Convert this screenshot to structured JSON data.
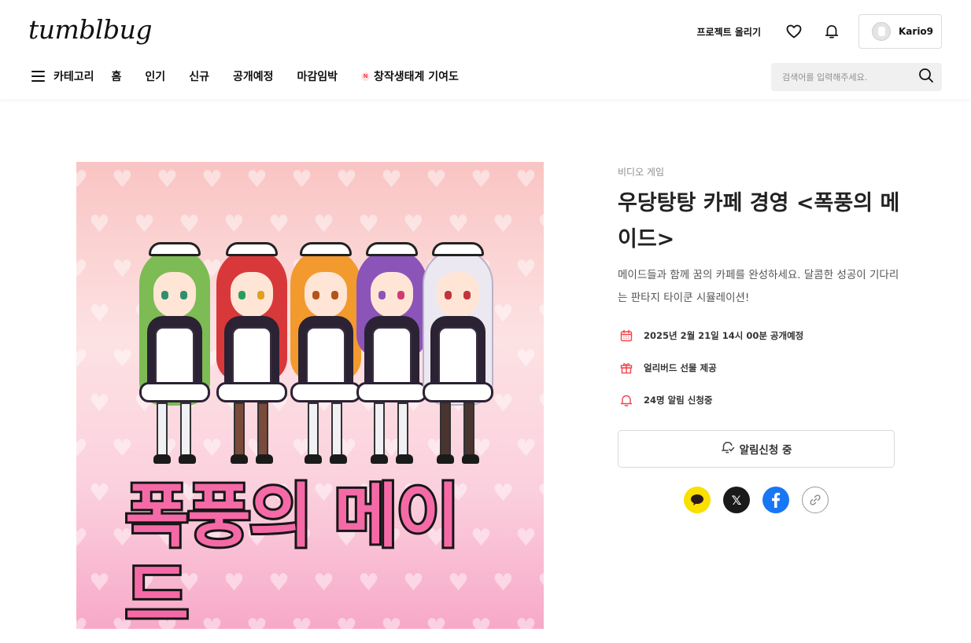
{
  "header": {
    "logo": "tumblbug",
    "upload_label": "프로젝트 올리기",
    "user_name": "Kario9"
  },
  "nav": {
    "category_label": "카테고리",
    "items": [
      "홈",
      "인기",
      "신규",
      "공개예정",
      "마감임박"
    ],
    "special_item": "창작생태계 기여도",
    "special_badge": "N"
  },
  "search": {
    "placeholder": "검색어를 입력해주세요."
  },
  "project": {
    "image_title": "폭풍의 메이드",
    "category": "비디오 게임",
    "title": "우당탕탕 카페 경영 <폭풍의 메이드>",
    "description": "메이드들과 함께 꿈의 카페를 완성하세요. 달콤한 성공이 기다리는 판타지 타이쿤 시뮬레이션!",
    "meta": {
      "date": "2025년 2월 21일 14시 00분 공개예정",
      "gift": "얼리버드 선물 제공",
      "alarm": "24명 알림 신청중"
    },
    "notify_button": "알림신청 중"
  },
  "share": {
    "x_label": "𝕏"
  },
  "colors": {
    "accent": "#f3454b",
    "kakao": "#f9e000",
    "facebook": "#1877f2"
  }
}
